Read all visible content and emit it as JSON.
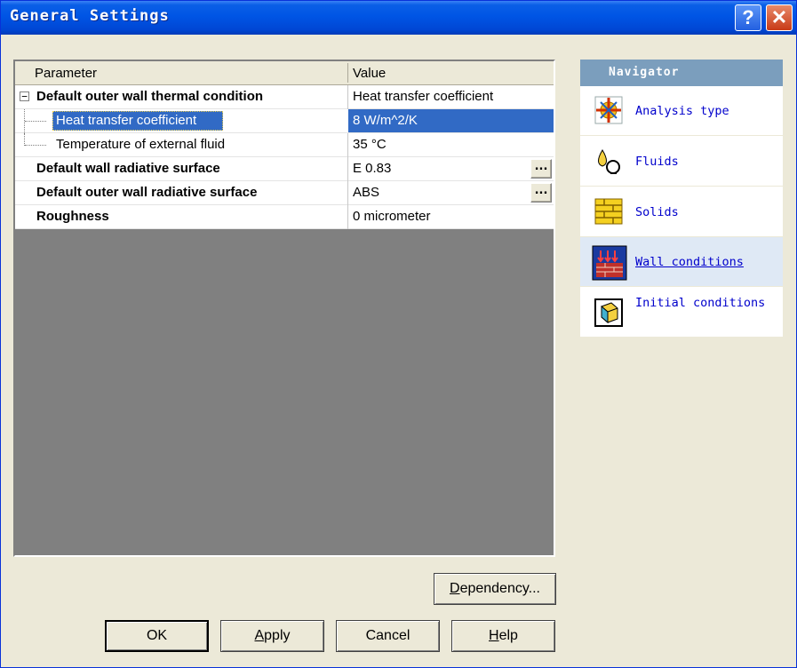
{
  "window": {
    "title": "General Settings",
    "help_glyph": "?",
    "close_glyph": "✕"
  },
  "grid": {
    "headers": {
      "parameter": "Parameter",
      "value": "Value"
    },
    "rows": [
      {
        "name": "Default outer wall thermal condition",
        "value": "Heat transfer coefficient",
        "bold": true,
        "expander": "−"
      },
      {
        "name": "Heat transfer coefficient",
        "value": "8 W/m^2/K",
        "bold": false,
        "selected": true
      },
      {
        "name": "Temperature of external fluid",
        "value": "35 °C",
        "bold": false
      },
      {
        "name": "Default wall radiative surface",
        "value": "E 0.83",
        "bold": true,
        "ellipsis": "..."
      },
      {
        "name": "Default outer wall radiative surface",
        "value": "ABS",
        "bold": true,
        "ellipsis": "..."
      },
      {
        "name": "Roughness",
        "value": "0 micrometer",
        "bold": true
      }
    ]
  },
  "navigator": {
    "title": "Navigator",
    "items": [
      {
        "label": "Analysis type",
        "icon": "analysis-type-icon"
      },
      {
        "label": "Fluids",
        "icon": "fluids-icon"
      },
      {
        "label": "Solids",
        "icon": "solids-icon"
      },
      {
        "label": " Wall conditions",
        "icon": "wall-conditions-icon",
        "active": true
      },
      {
        "label": "Initial conditions",
        "icon": "initial-conditions-icon"
      }
    ]
  },
  "buttons": {
    "dependency_prefix": "",
    "dependency_u": "D",
    "dependency_rest": "ependency...",
    "ok": "OK",
    "apply_u": "A",
    "apply_rest": "pply",
    "cancel": "Cancel",
    "help_u": "H",
    "help_rest": "elp"
  },
  "colors": {
    "title_bar": "#0055e5",
    "selection": "#316ac5",
    "nav_header": "#7b9ebd",
    "nav_link": "#0000cc",
    "grid_empty": "#808080"
  }
}
